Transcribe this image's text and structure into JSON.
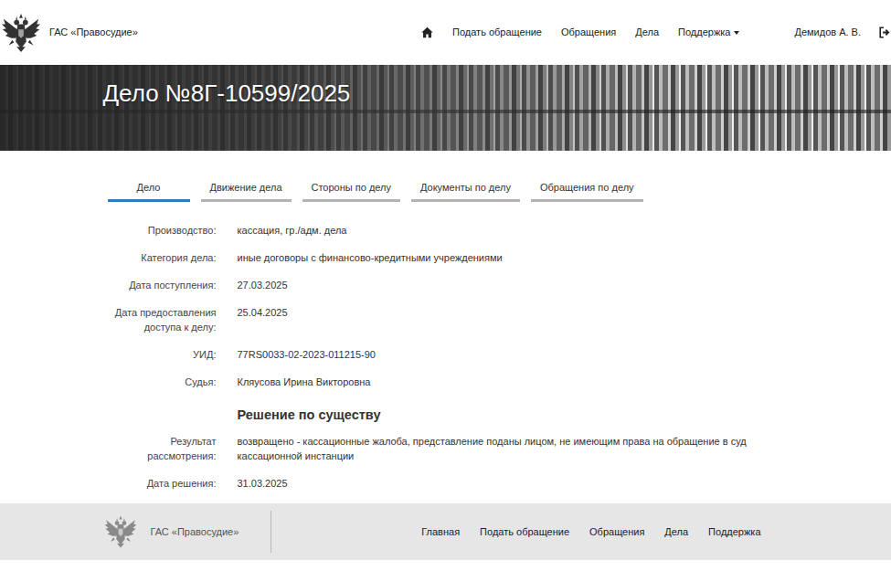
{
  "header": {
    "brand": "ГАС «Правосудие»",
    "nav": [
      {
        "label": "Подать обращение",
        "dropdown": false
      },
      {
        "label": "Обращения",
        "dropdown": false
      },
      {
        "label": "Дела",
        "dropdown": false
      },
      {
        "label": "Поддержка",
        "dropdown": true
      }
    ],
    "user": "Демидов А. В."
  },
  "banner": {
    "title": "Дело №8Г-10599/2025"
  },
  "tabs": [
    {
      "label": "Дело",
      "selected": true
    },
    {
      "label": "Движение дела",
      "selected": false
    },
    {
      "label": "Стороны по делу",
      "selected": false
    },
    {
      "label": "Документы по делу",
      "selected": false
    },
    {
      "label": "Обращения по делу",
      "selected": false
    }
  ],
  "fields": [
    {
      "label": "Производство:",
      "value": "кассация, гр./адм. дела"
    },
    {
      "label": "Категория дела:",
      "value": "иные договоры с финансово-кредитными учреждениями"
    },
    {
      "label": "Дата поступления:",
      "value": "27.03.2025"
    },
    {
      "label": "Дата предоставления доступа к делу:",
      "value": "25.04.2025"
    },
    {
      "label": "УИД:",
      "value": "77RS0033-02-2023-011215-90"
    },
    {
      "label": "Судья:",
      "value": "Кляусова Ирина Викторовна"
    }
  ],
  "decision": {
    "heading": "Решение по существу",
    "fields": [
      {
        "label": "Результат рассмотрения:",
        "value": "возвращено - кассационные жалоба, представление поданы лицом, не имеющим права на обращение в суд кассационной инстанции"
      },
      {
        "label": "Дата решения:",
        "value": "31.03.2025"
      }
    ]
  },
  "footer": {
    "brand": "ГАС «Правосудие»",
    "links": [
      "Главная",
      "Подать обращение",
      "Обращения",
      "Дела",
      "Поддержка"
    ]
  }
}
